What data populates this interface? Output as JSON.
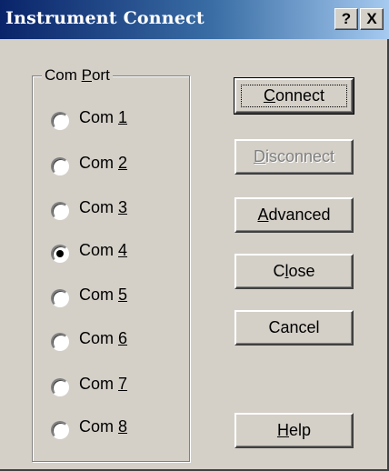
{
  "window": {
    "title": "Instrument Connect",
    "help_button": "?",
    "close_button": "X"
  },
  "com_port_group": {
    "label_pre": "Com ",
    "label_mnemonic": "P",
    "label_post": "ort",
    "selected": "Com 4",
    "options": [
      {
        "pre": "Com ",
        "mnemonic": "1",
        "checked": false
      },
      {
        "pre": "Com ",
        "mnemonic": "2",
        "checked": false
      },
      {
        "pre": "Com ",
        "mnemonic": "3",
        "checked": false
      },
      {
        "pre": "Com ",
        "mnemonic": "4",
        "checked": true
      },
      {
        "pre": "Com ",
        "mnemonic": "5",
        "checked": false
      },
      {
        "pre": "Com ",
        "mnemonic": "6",
        "checked": false
      },
      {
        "pre": "Com ",
        "mnemonic": "7",
        "checked": false
      },
      {
        "pre": "Com ",
        "mnemonic": "8",
        "checked": false
      }
    ]
  },
  "buttons": {
    "connect": {
      "mnemonic": "C",
      "rest": "onnect"
    },
    "disconnect": {
      "mnemonic": "D",
      "rest": "isconnect"
    },
    "advanced": {
      "mnemonic": "A",
      "rest": "dvanced"
    },
    "close": {
      "pre": "C",
      "mnemonic": "l",
      "rest": "ose"
    },
    "cancel": {
      "label": "Cancel"
    },
    "help": {
      "mnemonic": "H",
      "rest": "elp"
    }
  }
}
